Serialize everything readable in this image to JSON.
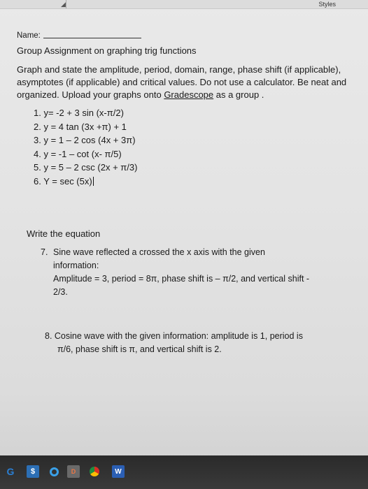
{
  "toolbar": {
    "styles_label": "Styles"
  },
  "document": {
    "name_label": "Name:",
    "title": "Group Assignment on graphing trig functions",
    "instructions_pre": "Graph and state the amplitude, period, domain, range, phase shift (if applicable), asymptotes (if applicable) and critical values. Do not use a calculator.  Be neat and organized.  Upload your graphs onto ",
    "instructions_link": "Gradescope",
    "instructions_post": " as a group .",
    "problems": [
      "1. y= -2 + 3 sin (x-π/2)",
      "2. y = 4 tan (3x +π) + 1",
      "3.  y = 1 – 2 cos (4x + 3π)",
      "4.  y = -1 – cot (x- π/5)",
      "5.  y = 5 – 2 csc (2x + π/3)",
      "6.  Y = sec (5x)"
    ],
    "write_equation_heading": "Write the equation",
    "q7": {
      "number": "7.",
      "line1": "Sine wave reflected a crossed the x axis with the given",
      "line2": "information:",
      "line3": "Amplitude = 3, period = 8π, phase shift is – π/2, and vertical shift -",
      "line4": "2/3."
    },
    "q8": {
      "line1": "8.   Cosine wave with the given information:  amplitude is 1, period is",
      "line2": "π/6, phase shift is π, and vertical shift is 2."
    }
  },
  "taskbar": {
    "items": [
      "G",
      "$",
      "",
      "D",
      "",
      "W"
    ]
  }
}
